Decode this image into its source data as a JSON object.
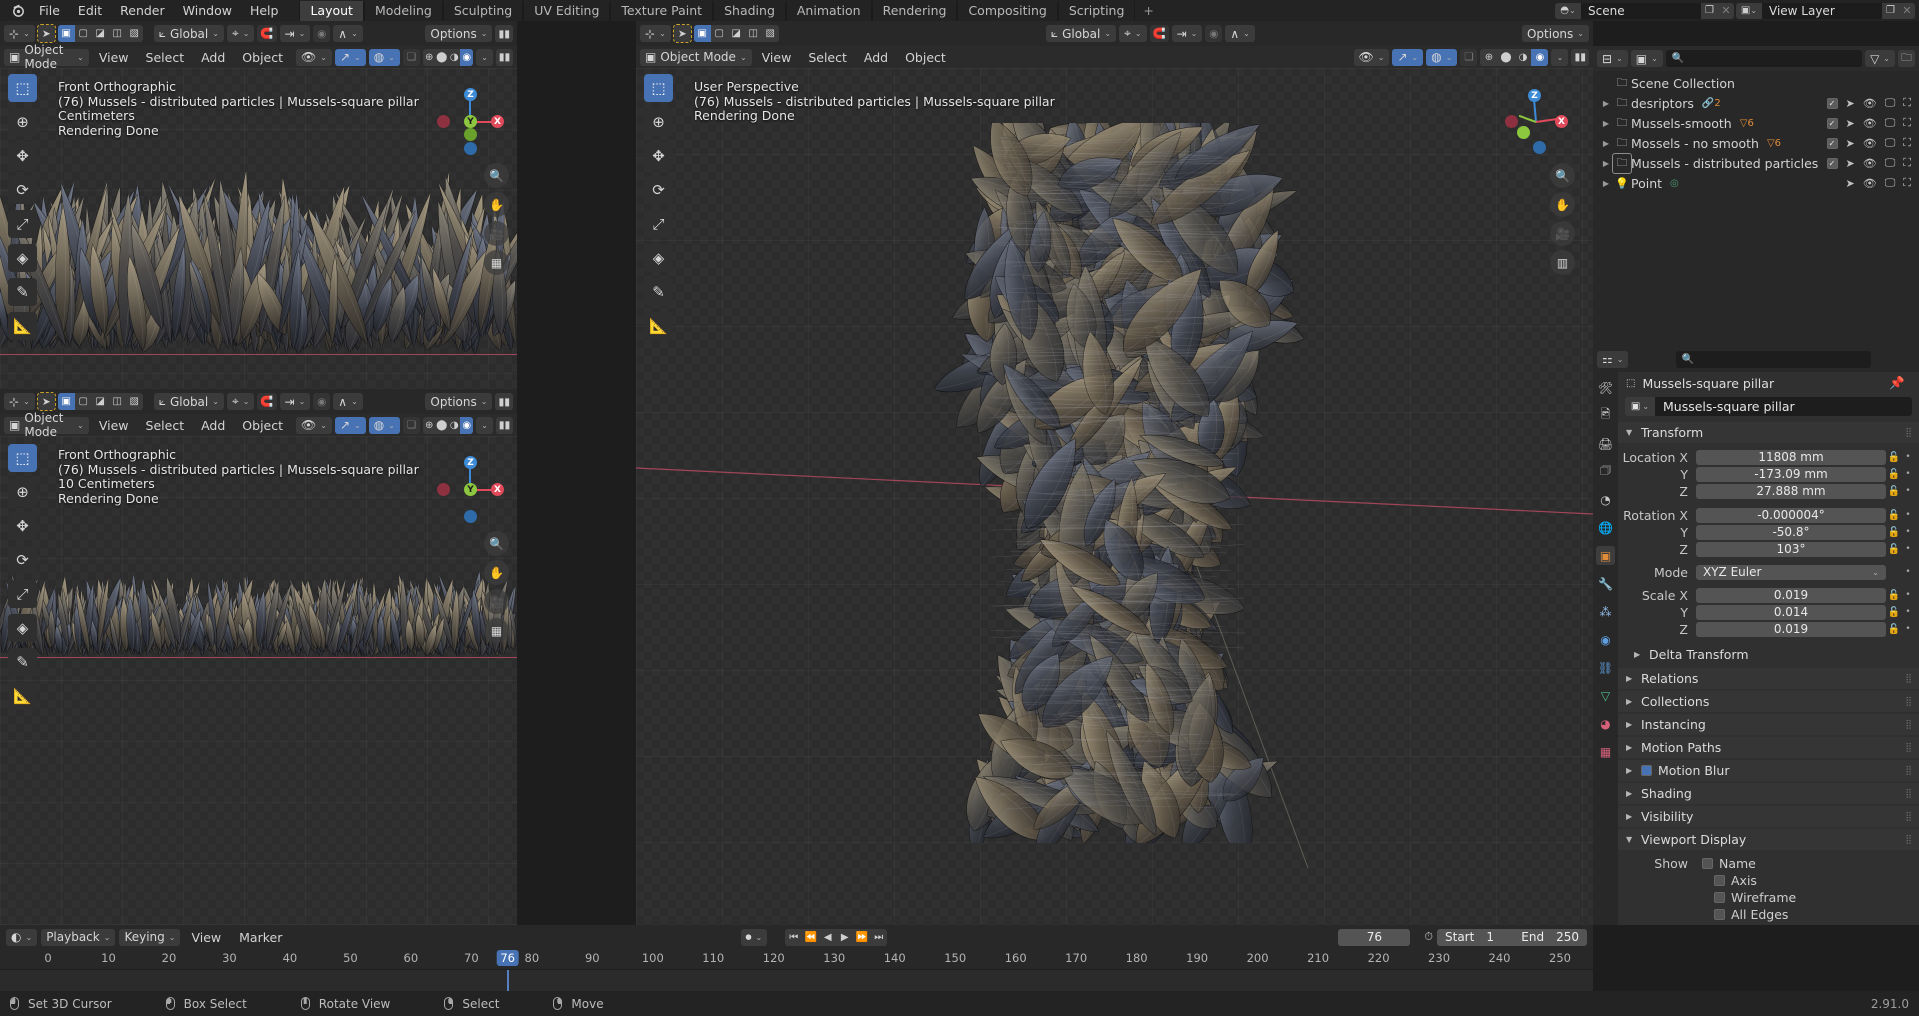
{
  "app": {
    "version": "2.91.0"
  },
  "topbar": {
    "menus": [
      "File",
      "Edit",
      "Render",
      "Window",
      "Help"
    ],
    "workspaces": [
      "Layout",
      "Modeling",
      "Sculpting",
      "UV Editing",
      "Texture Paint",
      "Shading",
      "Animation",
      "Rendering",
      "Compositing",
      "Scripting"
    ],
    "active_workspace": "Layout",
    "add_workspace": "+",
    "scene_name": "Scene",
    "viewlayer_name": "View Layer"
  },
  "viewport_top_left": {
    "tool_header": {
      "transform_orientation": "Global",
      "options": "Options"
    },
    "header": {
      "mode": "Object Mode",
      "menus": [
        "View",
        "Select",
        "Add",
        "Object"
      ]
    },
    "overlay": {
      "view_name": "Front Orthographic",
      "object_info": "(76) Mussels - distributed particles | Mussels-square pillar",
      "grid_scale": "Centimeters",
      "status": "Rendering Done"
    }
  },
  "viewport_bottom_left": {
    "tool_header": {
      "transform_orientation": "Global",
      "options": "Options"
    },
    "header": {
      "mode": "Object Mode",
      "menus": [
        "View",
        "Select",
        "Add",
        "Object"
      ]
    },
    "overlay": {
      "view_name": "Front Orthographic",
      "object_info": "(76) Mussels - distributed particles | Mussels-square pillar",
      "grid_scale": "10 Centimeters",
      "status": "Rendering Done"
    }
  },
  "viewport_right": {
    "tool_header": {
      "transform_orientation": "Global",
      "options": "Options"
    },
    "header": {
      "mode": "Object Mode",
      "menus": [
        "View",
        "Select",
        "Add",
        "Object"
      ]
    },
    "overlay": {
      "view_name": "User Perspective",
      "object_info": "(76) Mussels - distributed particles | Mussels-square pillar",
      "status": "Rendering Done"
    }
  },
  "outliner": {
    "search_placeholder": "",
    "root": "Scene Collection",
    "items": [
      {
        "label": "desriptors",
        "icon": "collection-icon",
        "badge": "2",
        "badge_icon": "modifier-icon",
        "selected": false,
        "checkbox": true
      },
      {
        "label": "Mussels-smooth",
        "icon": "collection-icon",
        "badge": "6",
        "badge_icon": "particles-icon",
        "selected": false,
        "checkbox": true
      },
      {
        "label": "Mossels - no smooth",
        "icon": "collection-icon",
        "badge": "6",
        "badge_icon": "particles-icon",
        "selected": false,
        "checkbox": true
      },
      {
        "label": "Mussels - distributed particles",
        "icon": "collection-icon",
        "badge": "",
        "badge_icon": "",
        "selected": true,
        "checkbox": true
      },
      {
        "label": "Point",
        "icon": "light-icon",
        "badge": "",
        "badge_icon": "light-data-icon",
        "selected": false,
        "checkbox": false
      }
    ]
  },
  "properties": {
    "search_placeholder": "",
    "breadcrumb_object": "Mussels-square pillar",
    "object_name_field": "Mussels-square pillar",
    "panels": {
      "transform": {
        "title": "Transform",
        "location": {
          "label_x": "Location X",
          "label_y": "Y",
          "label_z": "Z",
          "x": "11808 mm",
          "y": "-173.09 mm",
          "z": "27.888 mm"
        },
        "rotation": {
          "label_x": "Rotation X",
          "label_y": "Y",
          "label_z": "Z",
          "x": "-0.000004°",
          "y": "-50.8°",
          "z": "103°"
        },
        "mode": {
          "label": "Mode",
          "value": "XYZ Euler"
        },
        "scale": {
          "label_x": "Scale X",
          "label_y": "Y",
          "label_z": "Z",
          "x": "0.019",
          "y": "0.014",
          "z": "0.019"
        },
        "delta_transform": "Delta Transform"
      },
      "collapsed": [
        "Relations",
        "Collections",
        "Instancing",
        "Motion Paths"
      ],
      "motion_blur": "Motion Blur",
      "shading": "Shading",
      "visibility": "Visibility",
      "viewport_display": {
        "title": "Viewport Display",
        "show_label": "Show",
        "options": [
          "Name",
          "Axis",
          "Wireframe",
          "All Edges"
        ]
      }
    }
  },
  "timeline": {
    "menus": [
      "Playback",
      "Keying",
      "View",
      "Marker"
    ],
    "current_frame": "76",
    "start_label": "Start",
    "start_value": "1",
    "end_label": "End",
    "end_value": "250",
    "ticks": [
      "0",
      "10",
      "20",
      "30",
      "40",
      "50",
      "60",
      "70",
      "80",
      "90",
      "100",
      "110",
      "120",
      "130",
      "140",
      "150",
      "160",
      "170",
      "180",
      "190",
      "200",
      "210",
      "220",
      "230",
      "240",
      "250"
    ],
    "playhead_frame": "76"
  },
  "status_bar": {
    "hints": [
      {
        "mouse": "left",
        "label": "Set 3D Cursor"
      },
      {
        "mouse": "left",
        "label": "Box Select"
      },
      {
        "mouse": "mid",
        "label": "Rotate View"
      },
      {
        "mouse": "right",
        "label": "Select"
      },
      {
        "mouse": "right",
        "label": "Move"
      }
    ],
    "version": "2.91.0"
  },
  "colors": {
    "accent": "#4772b3",
    "header": "#282828",
    "panel": "#303030",
    "axis_x": "#e04a5a",
    "axis_y": "#8dc73f",
    "axis_z": "#3d8ad6",
    "orange": "#e08b3a"
  }
}
